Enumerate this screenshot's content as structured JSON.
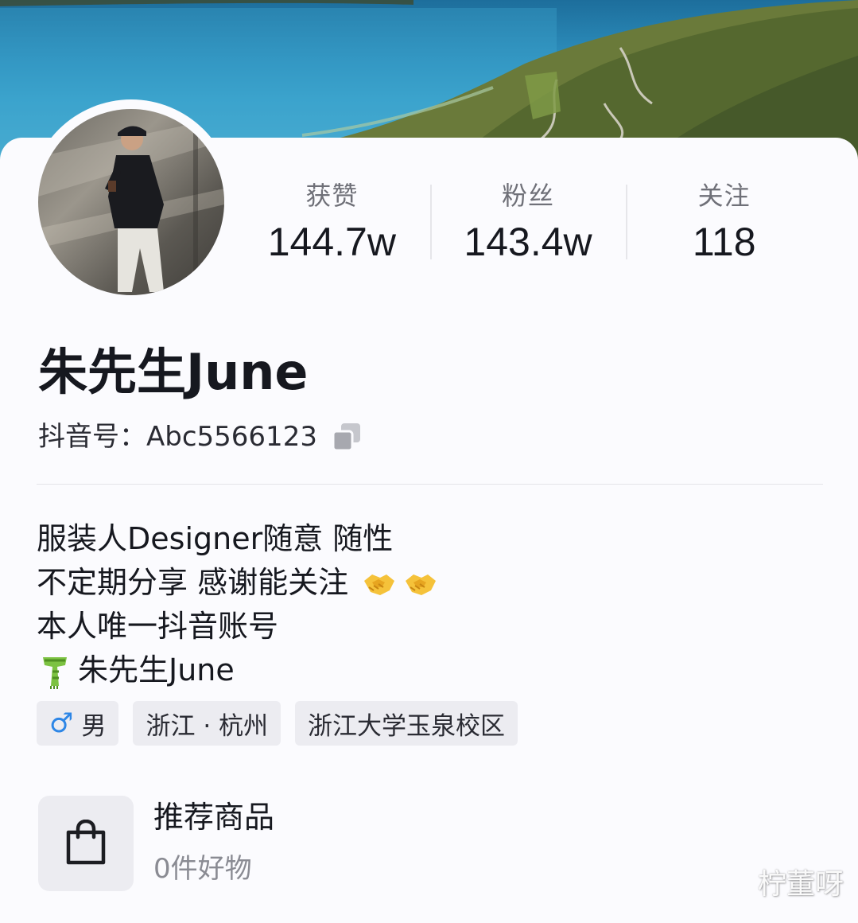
{
  "stats": [
    {
      "label": "获赞",
      "value": "144.7w"
    },
    {
      "label": "粉丝",
      "value": "143.4w"
    },
    {
      "label": "关注",
      "value": "118"
    }
  ],
  "profile": {
    "name": "朱先生June",
    "id_text": "抖音号：Abc5566123"
  },
  "bio": {
    "line1": "服装人Designer随意 随性",
    "line2": "不定期分享 感谢能关注",
    "line2_emoji": [
      "handshake-emoji",
      "handshake-emoji"
    ],
    "line3": "本人唯一抖音账号",
    "line4_emoji": "scarf-emoji",
    "line4": "朱先生June"
  },
  "tags": {
    "gender_icon": "♂",
    "gender": "男",
    "location": "浙江 · 杭州",
    "school": "浙江大学玉泉校区"
  },
  "goods": {
    "icon": "shopping-bag-icon",
    "title": "推荐商品",
    "subtitle": "0件好物"
  },
  "watermark": "柠董呀",
  "colors": {
    "male_blue": "#2d86e6",
    "tag_bg": "#ececf1",
    "card_bg": "#fbfbfe"
  }
}
